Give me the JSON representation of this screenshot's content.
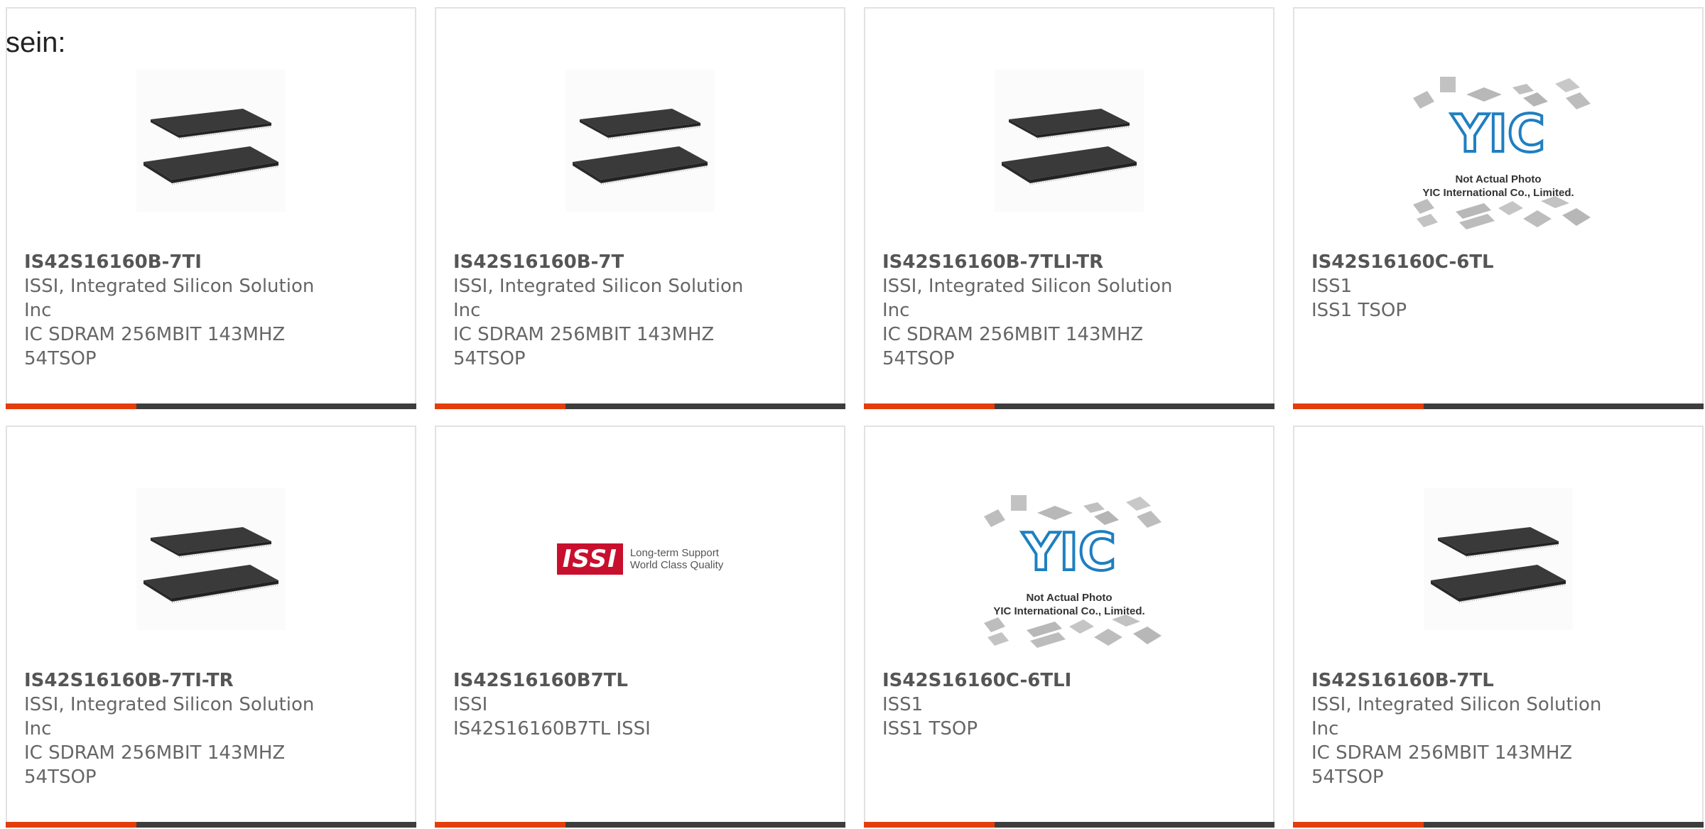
{
  "heading": "sein:",
  "colors": {
    "accent_bar": "#e33d0c",
    "dark_bar": "#3d3d3d",
    "card_border": "#e2e2e2",
    "issi_red": "#c8102e",
    "yic_blue": "#1f7fc0"
  },
  "products": [
    {
      "part": "IS42S16160B-7TI",
      "manufacturer": "ISSI, Integrated Silicon Solution Inc",
      "description": "IC SDRAM 256MBIT 143MHZ 54TSOP",
      "image": "tsop-chip-photo"
    },
    {
      "part": "IS42S16160B-7T",
      "manufacturer": "ISSI, Integrated Silicon Solution Inc",
      "description": "IC SDRAM 256MBIT 143MHZ 54TSOP",
      "image": "tsop-chip-photo"
    },
    {
      "part": "IS42S16160B-7TLI-TR",
      "manufacturer": "ISSI, Integrated Silicon Solution Inc",
      "description": "IC SDRAM 256MBIT 143MHZ 54TSOP",
      "image": "tsop-chip-photo"
    },
    {
      "part": "IS42S16160C-6TL",
      "manufacturer": "ISS1",
      "description": "ISS1 TSOP",
      "image": "yic-placeholder",
      "image_text_1": "Not Actual Photo",
      "image_text_2": "YIC International Co., Limited."
    },
    {
      "part": "IS42S16160B-7TI-TR",
      "manufacturer": "ISSI, Integrated Silicon Solution Inc",
      "description": "IC SDRAM 256MBIT 143MHZ 54TSOP",
      "image": "tsop-chip-photo"
    },
    {
      "part": "IS42S16160B7TL",
      "manufacturer": "ISSI",
      "description": "IS42S16160B7TL ISSI",
      "image": "issi-logo",
      "logo_text": "ISSI",
      "logo_tagline_1": "Long-term Support",
      "logo_tagline_2": "World Class Quality"
    },
    {
      "part": "IS42S16160C-6TLI",
      "manufacturer": "ISS1",
      "description": "ISS1 TSOP",
      "image": "yic-placeholder",
      "image_text_1": "Not Actual Photo",
      "image_text_2": "YIC International Co., Limited."
    },
    {
      "part": "IS42S16160B-7TL",
      "manufacturer": "ISSI, Integrated Silicon Solution Inc",
      "description": "IC SDRAM 256MBIT 143MHZ 54TSOP",
      "image": "tsop-chip-photo"
    }
  ]
}
